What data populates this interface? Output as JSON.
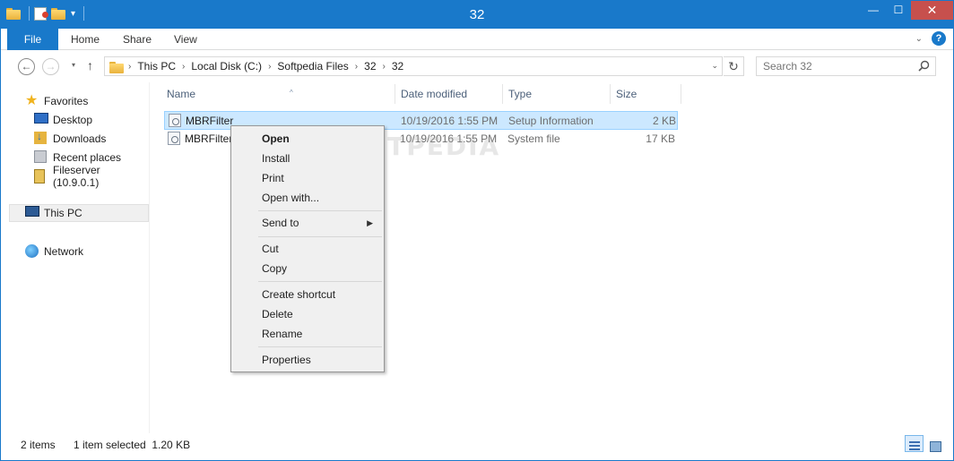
{
  "window": {
    "title": "32",
    "controls": {
      "minimize": "—",
      "maximize": "☐",
      "close": "✕"
    },
    "accent": "#1979ca"
  },
  "ribbon": {
    "tabs": [
      {
        "label": "File"
      },
      {
        "label": "Home"
      },
      {
        "label": "Share"
      },
      {
        "label": "View"
      }
    ],
    "help": "?"
  },
  "nav": {
    "breadcrumbs": [
      "This PC",
      "Local Disk (C:)",
      "Softpedia Files",
      "32",
      "32"
    ],
    "search_placeholder": "Search 32"
  },
  "sidebar": {
    "items": [
      {
        "label": "Favorites",
        "icon": "star-icon"
      },
      {
        "label": "Desktop",
        "icon": "desktop-icon"
      },
      {
        "label": "Downloads",
        "icon": "downloads-icon"
      },
      {
        "label": "Recent places",
        "icon": "recent-places-icon"
      },
      {
        "label": "Fileserver (10.9.0.1)",
        "icon": "network-drive-icon"
      },
      {
        "label": "This PC",
        "icon": "computer-icon"
      },
      {
        "label": "Network",
        "icon": "network-icon"
      }
    ]
  },
  "files": {
    "columns": [
      "Name",
      "Date modified",
      "Type",
      "Size"
    ],
    "rows": [
      {
        "name": "MBRFilter",
        "date": "10/19/2016 1:55 PM",
        "type": "Setup Information",
        "size": "2 KB"
      },
      {
        "name": "MBRFilter",
        "date": "10/19/2016 1:55 PM",
        "type": "System file",
        "size": "17 KB"
      }
    ]
  },
  "watermark": "SOFTPEDIA",
  "context_menu": {
    "items": [
      "Open",
      "Install",
      "Print",
      "Open with...",
      "Send to",
      "Cut",
      "Copy",
      "Create shortcut",
      "Delete",
      "Rename",
      "Properties"
    ]
  },
  "status": {
    "item_count": "2 items",
    "selection": "1 item selected  1.20 KB"
  }
}
